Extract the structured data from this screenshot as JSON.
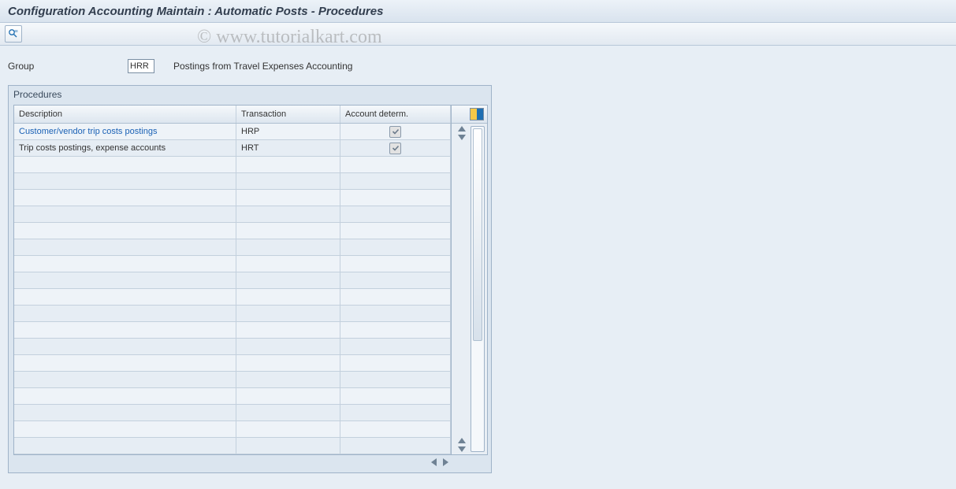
{
  "window": {
    "title": "Configuration Accounting Maintain : Automatic Posts - Procedures"
  },
  "toolbar": {
    "view_icon": "detail-view-icon"
  },
  "group_field": {
    "label": "Group",
    "value": "HRR",
    "description": "Postings from Travel Expenses Accounting"
  },
  "panel": {
    "title": "Procedures",
    "columns": {
      "description": "Description",
      "transaction": "Transaction",
      "account_determ": "Account determ."
    },
    "rows": [
      {
        "description": "Customer/vendor trip costs postings",
        "transaction": "HRP",
        "account_determ": true,
        "is_link": true
      },
      {
        "description": "Trip costs postings, expense accounts",
        "transaction": "HRT",
        "account_determ": true,
        "is_link": false
      }
    ],
    "empty_row_count": 18
  },
  "watermark": "© www.tutorialkart.com"
}
